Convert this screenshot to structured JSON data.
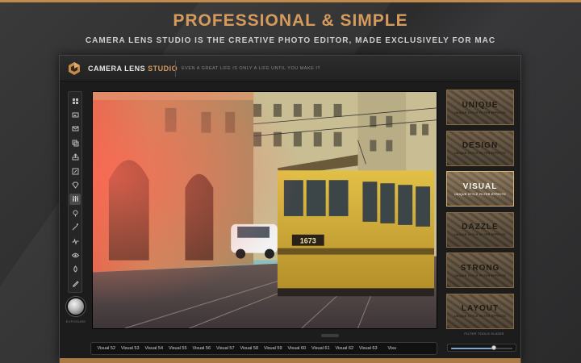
{
  "banner": {
    "headline": "PROFESSIONAL & SIMPLE",
    "subheadline": "CAMERA LENS STUDIO IS THE CREATIVE PHOTO EDITOR, MADE EXCLUSIVELY FOR MAC"
  },
  "app": {
    "name_part1": "CAMERA LENS ",
    "name_part2": "STUDIO",
    "tagline": "EVEN A GREAT LIFE IS ONLY A LIFE UNTIL YOU MAKE IT",
    "accent_color": "#d69b5c"
  },
  "toolbar": {
    "tools": [
      {
        "icon": "grid-icon"
      },
      {
        "icon": "image-icon"
      },
      {
        "icon": "mail-icon"
      },
      {
        "icon": "copy-icon"
      },
      {
        "icon": "share-icon"
      },
      {
        "icon": "edit-icon"
      },
      {
        "icon": "diamond-icon"
      },
      {
        "icon": "sliders-icon",
        "active": true
      },
      {
        "icon": "pin-icon"
      },
      {
        "icon": "wand-icon"
      },
      {
        "icon": "pulse-icon"
      },
      {
        "icon": "eye-icon"
      },
      {
        "icon": "drop-icon"
      },
      {
        "icon": "pencil-icon"
      }
    ],
    "knob_label": "EXPOSURE"
  },
  "photo": {
    "tram_number": "1673"
  },
  "filmstrip": {
    "items": [
      "Visual 52",
      "Visual 53",
      "Visual 54",
      "Visual 55",
      "Visual 56",
      "Visual 57",
      "Visual 58",
      "Visual 59",
      "Visual 60",
      "Visual 61",
      "Visual 62",
      "Visual 63",
      "Visu"
    ]
  },
  "effects": {
    "items": [
      {
        "name": "UNIQUE",
        "desc": "UNIQUE STYLE FILTER EFFECTS",
        "selected": false
      },
      {
        "name": "DESIGN",
        "desc": "UNIQUE STYLE FILTER EFFECTS",
        "selected": false
      },
      {
        "name": "VISUAL",
        "desc": "UNIQUE STYLE FILTER EFFECTS",
        "selected": true
      },
      {
        "name": "DAZZLE",
        "desc": "UNIQUE STYLE FILTER EFFECTS",
        "selected": false
      },
      {
        "name": "STRONG",
        "desc": "UNIQUE STYLE FILTER EFFECTS",
        "selected": false
      },
      {
        "name": "LAYOUT",
        "desc": "UNIQUE STYLE FILTER EFFECTS",
        "selected": false
      }
    ]
  },
  "slider": {
    "label": "FILTER TOOLS SLIDER",
    "value_fraction": 0.7
  }
}
